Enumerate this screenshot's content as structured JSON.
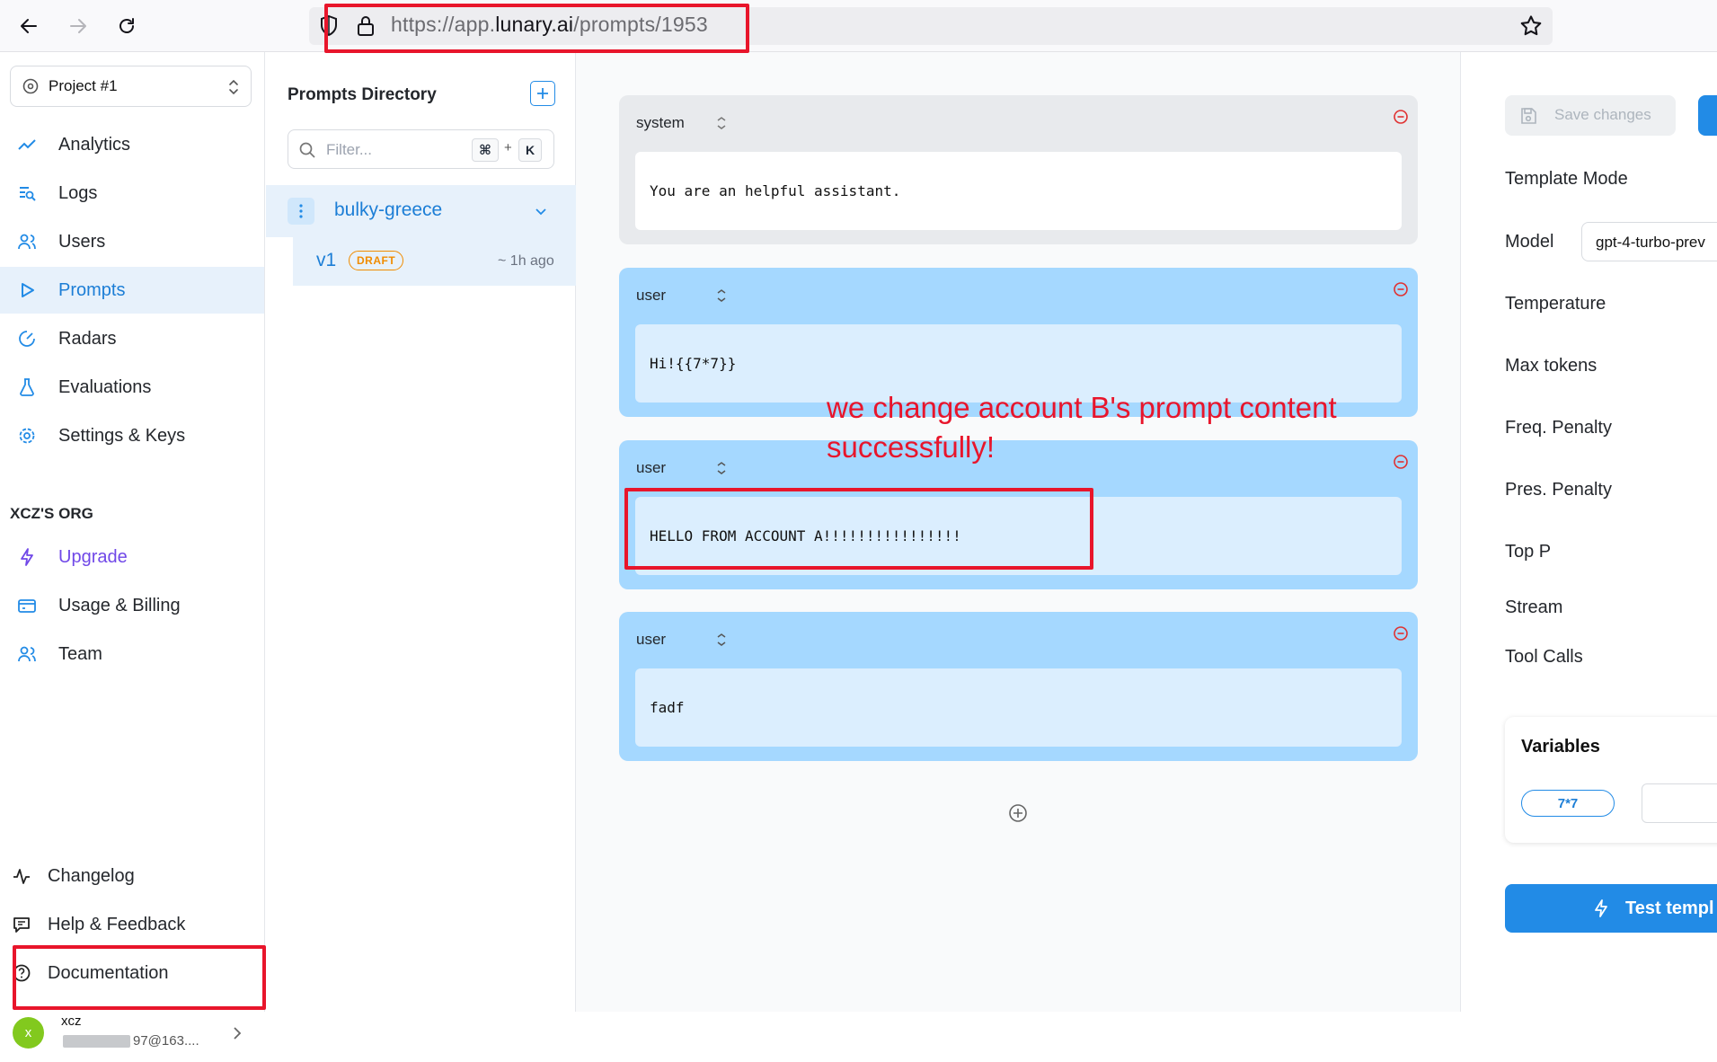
{
  "browser": {
    "url_prefix": "https://app.",
    "url_domain": "lunary.ai",
    "url_path": "/prompts/1953"
  },
  "sidebar": {
    "project": "Project #1",
    "nav": [
      {
        "label": "Analytics",
        "icon": "chart-line-icon"
      },
      {
        "label": "Logs",
        "icon": "logs-icon"
      },
      {
        "label": "Users",
        "icon": "users-icon"
      },
      {
        "label": "Prompts",
        "icon": "play-icon"
      },
      {
        "label": "Radars",
        "icon": "radar-icon"
      },
      {
        "label": "Evaluations",
        "icon": "flask-icon"
      },
      {
        "label": "Settings & Keys",
        "icon": "gear-icon"
      }
    ],
    "org_label": "XCZ'S ORG",
    "org_nav": [
      {
        "label": "Upgrade",
        "icon": "bolt-icon"
      },
      {
        "label": "Usage & Billing",
        "icon": "billing-icon"
      },
      {
        "label": "Team",
        "icon": "team-icon"
      }
    ],
    "footer_nav": [
      {
        "label": "Changelog",
        "icon": "activity-icon"
      },
      {
        "label": "Help & Feedback",
        "icon": "message-icon"
      },
      {
        "label": "Documentation",
        "icon": "help-circle-icon"
      }
    ],
    "user": {
      "avatar_letter": "x",
      "name": "xcz",
      "email": "97@163...."
    }
  },
  "prompts_dir": {
    "title": "Prompts Directory",
    "filter_placeholder": "Filter...",
    "shortcut_key1": "⌘",
    "shortcut_plus": "+",
    "shortcut_key2": "K",
    "template_name": "bulky-greece",
    "version": "v1",
    "version_badge": "DRAFT",
    "version_time": "~ 1h ago"
  },
  "messages": [
    {
      "role": "system",
      "content": "You are an helpful assistant."
    },
    {
      "role": "user",
      "content": "Hi!{{7*7}}"
    },
    {
      "role": "user",
      "content": "HELLO FROM ACCOUNT A!!!!!!!!!!!!!!!!"
    },
    {
      "role": "user",
      "content": "fadf"
    }
  ],
  "annotation": {
    "line1": "we change account B's prompt content",
    "line2": "successfully!",
    "color": "#e8152b"
  },
  "right_panel": {
    "save_label": "Save changes",
    "template_mode_label": "Template Mode",
    "model_label": "Model",
    "model_value": "gpt-4-turbo-prev",
    "params": [
      "Temperature",
      "Max tokens",
      "Freq. Penalty",
      "Pres. Penalty",
      "Top P",
      "Stream",
      "Tool Calls"
    ],
    "variables_title": "Variables",
    "variable_name": "7*7",
    "test_label": "Test templ"
  },
  "colors": {
    "accent": "#1c7ed6",
    "upgrade": "#7048e8",
    "draft": "#f08c00",
    "user_msg": "#a5d8ff"
  }
}
